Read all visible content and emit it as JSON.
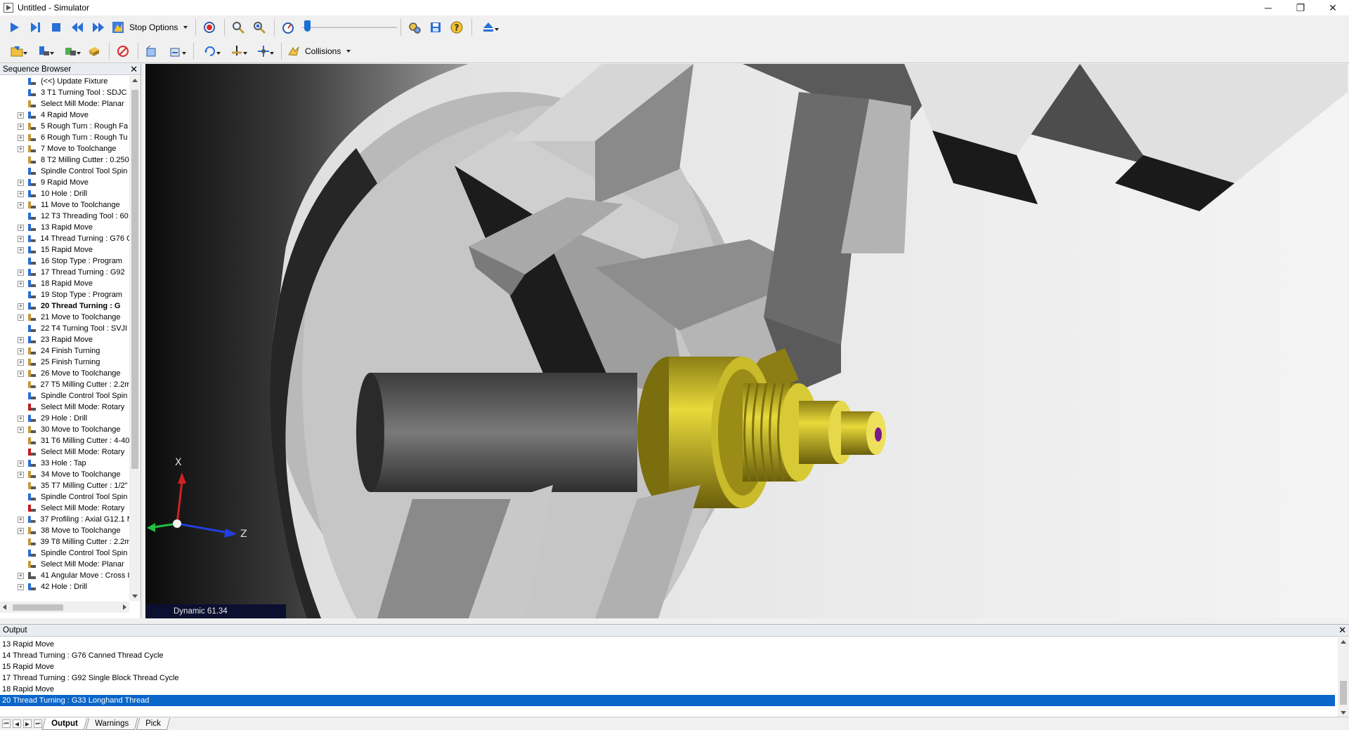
{
  "window": {
    "title": "Untitled - Simulator",
    "minimize": "─",
    "maximize": "❐",
    "close": "✕"
  },
  "toolbar": {
    "stop_options_label": "Stop Options",
    "collisions_label": "Collisions",
    "speed_level": 0.02
  },
  "sequence_browser": {
    "title": "Sequence Browser",
    "close": "✕",
    "items": [
      {
        "label": "(<<) Update Fixture",
        "icon": "fixture-icon",
        "expandable": false,
        "bold": false
      },
      {
        "label": "3 T1 Turning Tool : SDJC",
        "icon": "turning-tool-icon",
        "expandable": false,
        "bold": false
      },
      {
        "label": "Select Mill Mode: Planar",
        "icon": "mill-mode-planar-icon",
        "expandable": false,
        "bold": false
      },
      {
        "label": "4 Rapid Move",
        "icon": "rapid-move-icon",
        "expandable": true,
        "bold": false
      },
      {
        "label": "5 Rough Turn : Rough Fa",
        "icon": "rough-turn-icon",
        "expandable": true,
        "bold": false
      },
      {
        "label": "6 Rough Turn : Rough Tu",
        "icon": "rough-turn-icon",
        "expandable": true,
        "bold": false
      },
      {
        "label": "7 Move to Toolchange",
        "icon": "toolchange-icon",
        "expandable": true,
        "bold": false
      },
      {
        "label": "8 T2 Milling Cutter : 0.250",
        "icon": "milling-cutter-icon",
        "expandable": false,
        "bold": false
      },
      {
        "label": "Spindle Control Tool Spin",
        "icon": "spindle-control-icon",
        "expandable": false,
        "bold": false
      },
      {
        "label": "9 Rapid Move",
        "icon": "rapid-move-icon",
        "expandable": true,
        "bold": false
      },
      {
        "label": "10 Hole : Drill",
        "icon": "hole-icon",
        "expandable": true,
        "bold": false
      },
      {
        "label": "11 Move to Toolchange",
        "icon": "toolchange-icon",
        "expandable": true,
        "bold": false
      },
      {
        "label": "12 T3 Threading Tool : 60",
        "icon": "threading-tool-icon",
        "expandable": false,
        "bold": false
      },
      {
        "label": "13 Rapid Move",
        "icon": "rapid-move-icon",
        "expandable": true,
        "bold": false
      },
      {
        "label": "14 Thread Turning : G76 C",
        "icon": "thread-turning-icon",
        "expandable": true,
        "bold": false
      },
      {
        "label": "15 Rapid Move",
        "icon": "rapid-move-icon",
        "expandable": true,
        "bold": false
      },
      {
        "label": "16 Stop Type : Program",
        "icon": "stop-icon",
        "expandable": false,
        "bold": false
      },
      {
        "label": "17 Thread Turning : G92",
        "icon": "thread-turning-icon",
        "expandable": true,
        "bold": false
      },
      {
        "label": "18 Rapid Move",
        "icon": "rapid-move-icon",
        "expandable": true,
        "bold": false
      },
      {
        "label": "19 Stop Type : Program",
        "icon": "stop-icon",
        "expandable": false,
        "bold": false
      },
      {
        "label": "20 Thread Turning : G",
        "icon": "thread-turning-icon",
        "expandable": true,
        "bold": true
      },
      {
        "label": "21 Move to Toolchange",
        "icon": "toolchange-icon",
        "expandable": true,
        "bold": false
      },
      {
        "label": "22 T4 Turning Tool : SVJI",
        "icon": "turning-tool-icon",
        "expandable": false,
        "bold": false
      },
      {
        "label": "23 Rapid Move",
        "icon": "rapid-move-icon",
        "expandable": true,
        "bold": false
      },
      {
        "label": "24 Finish Turning",
        "icon": "finish-turning-icon",
        "expandable": true,
        "bold": false
      },
      {
        "label": "25 Finish Turning",
        "icon": "finish-turning-icon",
        "expandable": true,
        "bold": false
      },
      {
        "label": "26 Move to Toolchange",
        "icon": "toolchange-icon",
        "expandable": true,
        "bold": false
      },
      {
        "label": "27 T5 Milling Cutter : 2.2m",
        "icon": "milling-cutter-icon",
        "expandable": false,
        "bold": false
      },
      {
        "label": "Spindle Control Tool Spin",
        "icon": "spindle-control-icon",
        "expandable": false,
        "bold": false
      },
      {
        "label": "Select Mill Mode: Rotary",
        "icon": "mill-mode-rotary-icon",
        "expandable": false,
        "bold": false
      },
      {
        "label": "29 Hole : Drill",
        "icon": "hole-icon",
        "expandable": true,
        "bold": false
      },
      {
        "label": "30 Move to Toolchange",
        "icon": "toolchange-icon",
        "expandable": true,
        "bold": false
      },
      {
        "label": "31 T6 Milling Cutter : 4-40",
        "icon": "milling-cutter-icon",
        "expandable": false,
        "bold": false
      },
      {
        "label": "Select Mill Mode: Rotary",
        "icon": "mill-mode-rotary-icon",
        "expandable": false,
        "bold": false
      },
      {
        "label": "33 Hole : Tap",
        "icon": "hole-icon",
        "expandable": true,
        "bold": false
      },
      {
        "label": "34 Move to Toolchange",
        "icon": "toolchange-icon",
        "expandable": true,
        "bold": false
      },
      {
        "label": "35 T7 Milling Cutter : 1/2\"",
        "icon": "milling-cutter-icon",
        "expandable": false,
        "bold": false
      },
      {
        "label": "Spindle Control Tool Spin",
        "icon": "spindle-control-icon",
        "expandable": false,
        "bold": false
      },
      {
        "label": "Select Mill Mode: Rotary",
        "icon": "mill-mode-rotary-icon",
        "expandable": false,
        "bold": false
      },
      {
        "label": "37 Profiling : Axial G12.1 N",
        "icon": "profiling-icon",
        "expandable": true,
        "bold": false
      },
      {
        "label": "38 Move to Toolchange",
        "icon": "toolchange-icon",
        "expandable": true,
        "bold": false
      },
      {
        "label": "39 T8 Milling Cutter : 2.2m",
        "icon": "milling-cutter-icon",
        "expandable": false,
        "bold": false
      },
      {
        "label": "Spindle Control Tool Spin",
        "icon": "spindle-control-icon",
        "expandable": false,
        "bold": false
      },
      {
        "label": "Select Mill Mode: Planar",
        "icon": "mill-mode-planar-icon",
        "expandable": false,
        "bold": false
      },
      {
        "label": "41 Angular Move : Cross I",
        "icon": "angular-move-icon",
        "expandable": true,
        "bold": false
      },
      {
        "label": "42 Hole : Drill",
        "icon": "hole-icon",
        "expandable": true,
        "bold": false
      }
    ]
  },
  "viewport": {
    "status": "Dynamic 61.34",
    "axes": {
      "x": "X",
      "y": "Y",
      "z": "Z"
    }
  },
  "output": {
    "title": "Output",
    "close": "✕",
    "lines": [
      "13 Rapid Move",
      "14 Thread Turning : G76 Canned Thread Cycle",
      "15 Rapid Move",
      "17 Thread Turning : G92 Single Block Thread Cycle",
      "18 Rapid Move",
      "20 Thread Turning : G33 Longhand Thread"
    ],
    "selected_index": 5,
    "tabs": [
      "Output",
      "Warnings",
      "Pick"
    ],
    "active_tab": 0
  }
}
